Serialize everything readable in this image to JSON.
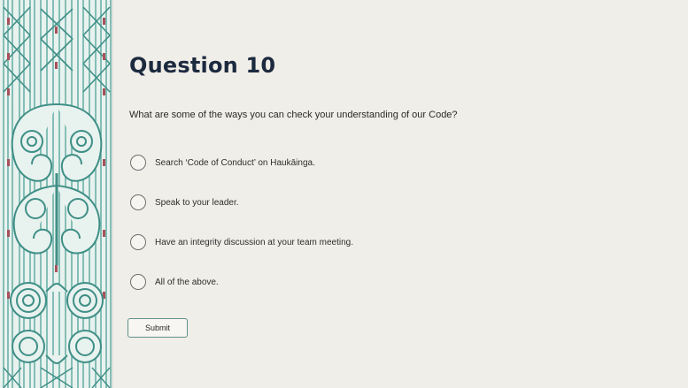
{
  "question": {
    "title": "Question 10",
    "prompt": "What are some of the ways you can check your understanding of our Code?",
    "options": [
      {
        "label": "Search ‘Code of Conduct’ on Haukāinga."
      },
      {
        "label": "Speak to your leader."
      },
      {
        "label": "Have an integrity discussion at your team meeting."
      },
      {
        "label": "All of the above."
      }
    ]
  },
  "actions": {
    "submit_label": "Submit"
  },
  "colors": {
    "background": "#f0eee8",
    "pattern_teal": "#5aa89e",
    "pattern_red": "#a8505a",
    "title_navy": "#1c2a3f"
  },
  "icons": {
    "option_marker": "radio-unchecked-icon",
    "border_art": "maori-kowhaiwhai-pattern"
  }
}
